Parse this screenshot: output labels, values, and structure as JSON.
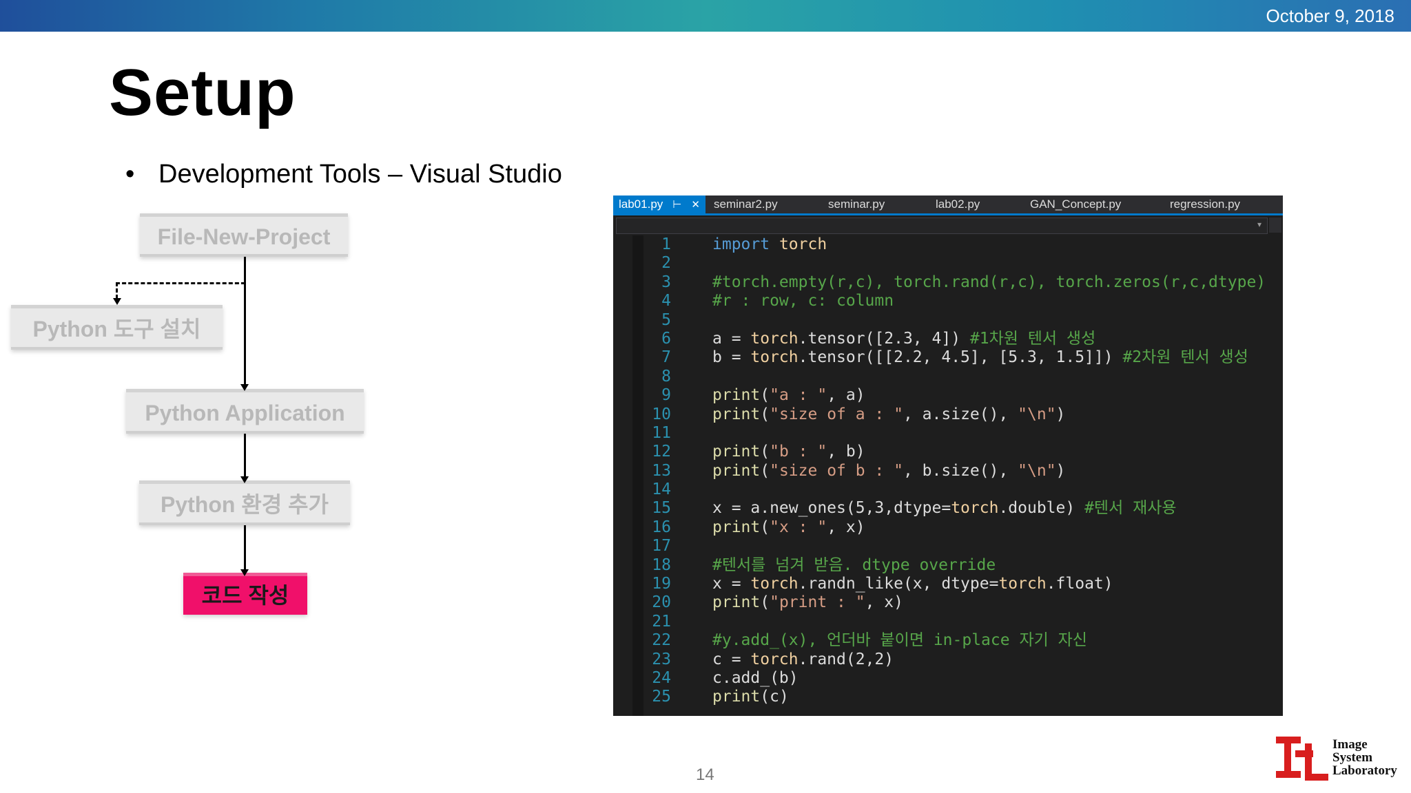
{
  "header": {
    "date": "October 9, 2018",
    "accent_color": "#1f7aa8"
  },
  "slide": {
    "title": "Setup",
    "bullet": "Development Tools – Visual Studio",
    "page_number": "14"
  },
  "flowchart": {
    "steps": [
      {
        "label": "File-New-Project"
      },
      {
        "label": "Python 도구 설치"
      },
      {
        "label": "Python Application"
      },
      {
        "label": "Python 환경 추가"
      },
      {
        "label": "코드 작성"
      }
    ],
    "highlight_color": "#f0106a"
  },
  "editor": {
    "tabs": [
      {
        "label": "lab01.py"
      },
      {
        "label": "seminar2.py"
      },
      {
        "label": "seminar.py"
      },
      {
        "label": "lab02.py"
      },
      {
        "label": "GAN_Concept.py"
      },
      {
        "label": "regression.py"
      }
    ],
    "pin_icon": "pin-icon",
    "close_icon": "close-icon",
    "line_numbers": [
      "1",
      "2",
      "3",
      "4",
      "5",
      "6",
      "7",
      "8",
      "9",
      "10",
      "11",
      "12",
      "13",
      "14",
      "15",
      "16",
      "17",
      "18",
      "19",
      "20",
      "21",
      "22",
      "23",
      "24",
      "25"
    ],
    "lines": [
      "import torch",
      "",
      "#torch.empty(r,c), torch.rand(r,c), torch.zeros(r,c,dtype)",
      "#r : row, c: column",
      "",
      "a = torch.tensor([2.3, 4]) #1차원 텐서 생성",
      "b = torch.tensor([[2.2, 4.5], [5.3, 1.5]]) #2차원 텐서 생성",
      "",
      "print(\"a : \", a)",
      "print(\"size of a : \", a.size(), \"\\n\")",
      "",
      "print(\"b : \", b)",
      "print(\"size of b : \", b.size(), \"\\n\")",
      "",
      "x = a.new_ones(5,3,dtype=torch.double) #텐서 재사용",
      "print(\"x : \", x)",
      "",
      "#텐서를 넘겨 받음. dtype override",
      "x = torch.randn_like(x, dtype=torch.float)",
      "print(\"print : \", x)",
      "",
      "#y.add_(x), 언더바 붙이면 in-place 자기 자신",
      "c = torch.rand(2,2)",
      "c.add_(b)",
      "print(c)"
    ]
  },
  "logo": {
    "text_lines": [
      "Image",
      "System",
      "Laboratory"
    ],
    "color": "#d81e1e"
  }
}
